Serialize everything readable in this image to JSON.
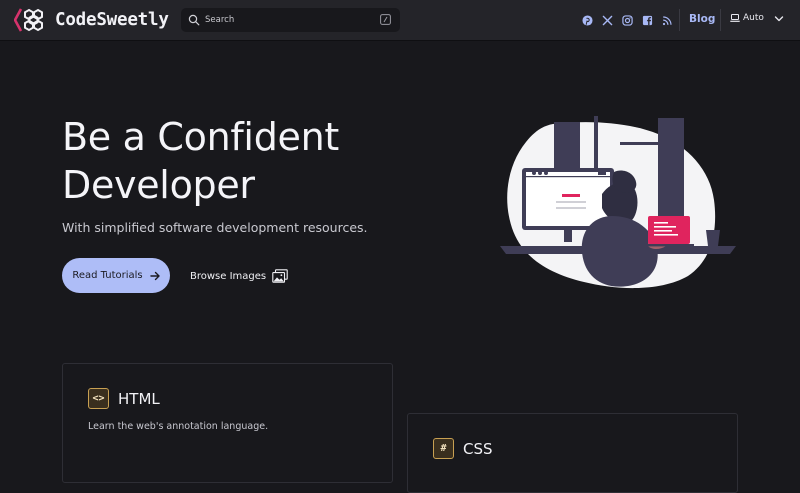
{
  "navbar": {
    "brand": "CodeSweetly",
    "search_placeholder": "Search",
    "socials": [
      "pinterest-icon",
      "x-icon",
      "instagram-icon",
      "facebook-icon",
      "rss-icon"
    ],
    "blog_label": "Blog",
    "theme_label": "Auto"
  },
  "hero": {
    "title": "Be a Confident Developer",
    "subtitle": "With simplified software development resources.",
    "primary_button": "Read Tutorials",
    "secondary_button": "Browse Images"
  },
  "cards": [
    {
      "icon": "code-icon",
      "icon_glyph": "<>",
      "title": "HTML",
      "description": "Learn the web's annotation language."
    },
    {
      "icon": "hash-icon",
      "icon_glyph": "#",
      "title": "CSS",
      "description": ""
    }
  ],
  "colors": {
    "background": "#18181c",
    "navbar": "#242429",
    "accent": "#aebdf7",
    "brand_logo": "#d6336c",
    "card_icon_border": "#c8a052"
  }
}
